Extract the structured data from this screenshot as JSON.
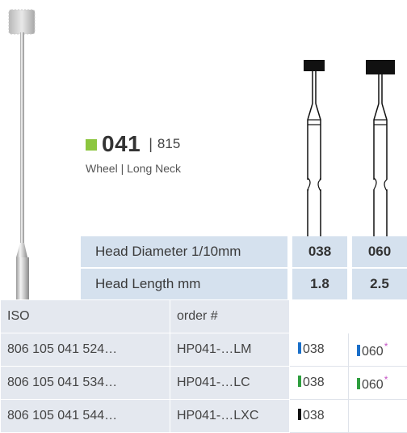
{
  "product": {
    "code": "041",
    "separator": "|",
    "reference": "815",
    "subtitle": "Wheel | Long Neck",
    "accent_color": "#8cc63f"
  },
  "specs": {
    "head_diameter": {
      "label": "Head Diameter 1/10mm",
      "values": [
        "038",
        "060"
      ]
    },
    "head_length": {
      "label": "Head Length mm",
      "values": [
        "1.8",
        "2.5"
      ]
    }
  },
  "table": {
    "headers": [
      "ISO",
      "order #"
    ],
    "rows": [
      {
        "iso": "806 105 041 524…",
        "order": "HP041-…LM",
        "variants": [
          {
            "size": "038",
            "color": "#1a6fc9",
            "star": ""
          },
          {
            "size": "060",
            "color": "#1a6fc9",
            "star": "*"
          }
        ]
      },
      {
        "iso": "806 105 041 534…",
        "order": "HP041-…LC",
        "variants": [
          {
            "size": "038",
            "color": "#2e9e3e",
            "star": ""
          },
          {
            "size": "060",
            "color": "#2e9e3e",
            "star": "*"
          }
        ]
      },
      {
        "iso": "806 105 041 544…",
        "order": "HP041-…LXC",
        "variants": [
          {
            "size": "038",
            "color": "#111111",
            "star": ""
          }
        ]
      }
    ]
  }
}
